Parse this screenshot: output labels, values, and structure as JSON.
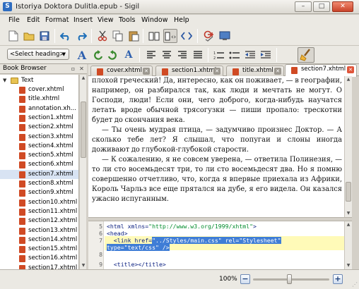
{
  "window": {
    "title": "Istoriya Doktora Dulitla.epub - Sigil",
    "app_icon_glyph": "S",
    "controls": {
      "minimize": "–",
      "maximize": "□",
      "close": "✕"
    }
  },
  "menu": [
    "File",
    "Edit",
    "Format",
    "Insert",
    "View",
    "Tools",
    "Window",
    "Help"
  ],
  "toolbar": {
    "heading_select": "<Select heading>",
    "heading_buttons": [
      "A",
      "A",
      "A",
      "A",
      "A"
    ],
    "icons_row1": [
      "new-file-icon",
      "open-folder-icon",
      "save-icon",
      "undo-icon",
      "redo-icon",
      "cut-icon",
      "copy-icon",
      "paste-icon",
      "book-view-icon",
      "split-view-icon",
      "code-view-icon",
      "spellcheck-icon",
      "preview-icon"
    ],
    "icons_row2": [
      "heading-select",
      "heading-icon",
      "undo-arrow-icon",
      "redo-arrow-icon",
      "text-style-icon",
      "align-left-icon",
      "align-center-icon",
      "align-right-icon",
      "align-justify-icon",
      "numbered-list-icon",
      "bullet-list-icon",
      "decrease-indent-icon",
      "increase-indent-icon",
      "clean-broom-icon"
    ]
  },
  "book_browser": {
    "header": "Book Browser",
    "float_glyph": "▫",
    "close_glyph": "✕",
    "folder": "Text",
    "files": [
      "cover.xhtml",
      "title.xhtml",
      "annotation.xh...",
      "section1.xhtml",
      "section2.xhtml",
      "section3.xhtml",
      "section4.xhtml",
      "section5.xhtml",
      "section6.xhtml",
      "section7.xhtml",
      "section8.xhtml",
      "section9.xhtml",
      "section10.xhtml",
      "section11.xhtml",
      "section12.xhtml",
      "section13.xhtml",
      "section14.xhtml",
      "section15.xhtml",
      "section16.xhtml",
      "section17.xhtml"
    ],
    "selected": "section7.xhtml"
  },
  "tabs": [
    {
      "label": "cover.xhtml",
      "active": false
    },
    {
      "label": "section1.xhtml",
      "active": false
    },
    {
      "label": "title.xhtml",
      "active": false
    },
    {
      "label": "section7.xhtml",
      "active": true
    }
  ],
  "book_text": [
    "плохой греческий! Да, интересно, как он поживает, — в географии, например, он разбирался так, как люди и мечтать не могут. О Господи, люди! Если они, чего доброго, когда-нибудь научатся летать вроде обычной трясогузки — пиши пропало: трескотни будет до скончания века.",
    "— Ты очень мудрая птица, — задумчиво произнес Доктор. — А сколько тебе лет? Я слышал, что попугаи и слоны иногда доживают до глубокой-глубокой старости.",
    "— К сожалению, я не совсем уверена, — ответила Полинезия, — то ли сто восемьдесят три, то ли сто восемьдесят два. Но я помню совершенно отчетливо, что, когда я впервые приехала из Африки, Король Чарльз все еще прятался на дубе, я его видела. Он казался ужасно испуганным."
  ],
  "code": {
    "line_numbers": [
      "5",
      "6",
      "7",
      "",
      "8",
      "9"
    ],
    "lines": {
      "l5a": "<html xmlns=",
      "l5b": "\"http://www.w3.org/1999/xhtml\"",
      "l5c": ">",
      "l6": "<head>",
      "l7a": "  <link href=",
      "l7b": "\"../Styles/main.css\"",
      "l7c": " rel=",
      "l7d": "\"Stylesheet\"",
      "l7e": "type=",
      "l7f": "\"text/css\"",
      "l7g": " />",
      "l9": "  <title></title>"
    }
  },
  "status": {
    "zoom": "100%",
    "zoom_out": "−",
    "zoom_in": "+",
    "zoom_level": 0.47
  },
  "colors": {
    "accent": "#3f7dd6",
    "selection_row": "#d8e3f3",
    "current_line": "#fffab8",
    "close_tab": "#e0553a",
    "heading_blue": "#2d5fae"
  }
}
